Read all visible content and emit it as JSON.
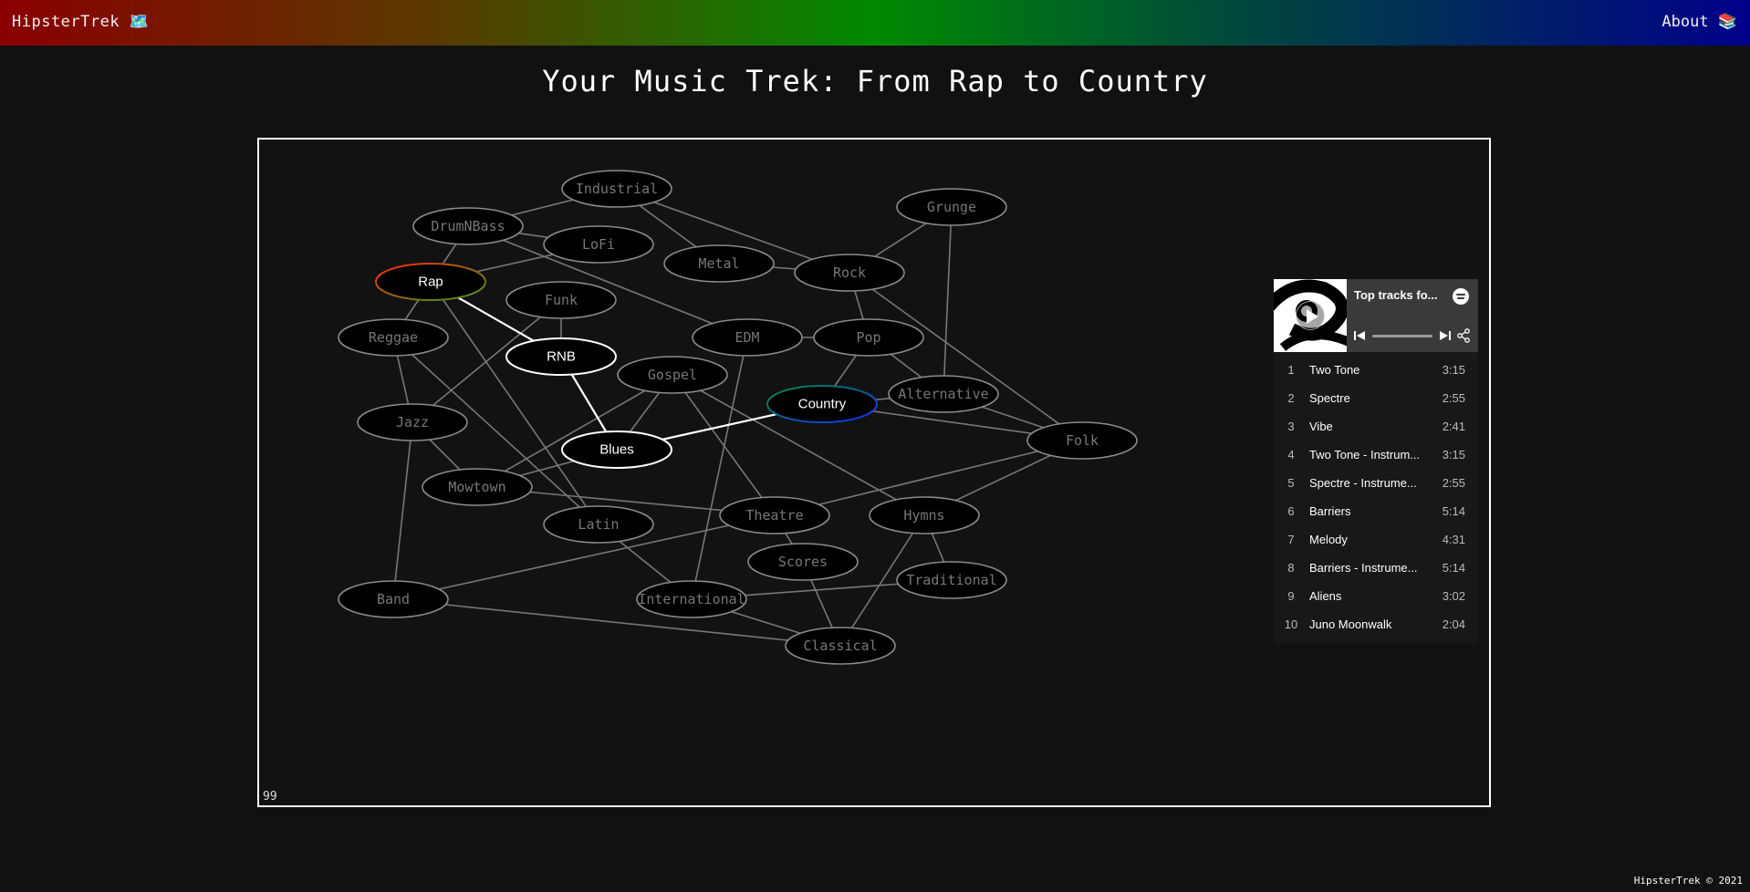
{
  "header": {
    "brand": "HipsterTrek 🗺️",
    "about": "About 📚"
  },
  "page_title": "Your Music Trek: From Rap to Country",
  "graph": {
    "counter": "99",
    "start_node": "Rap",
    "end_node": "Country",
    "path": [
      "Rap",
      "RNB",
      "Blues",
      "Country"
    ],
    "colors": {
      "start_stroke_a": "#ff2a00",
      "start_stroke_b": "#3a9a20",
      "end_stroke_a": "#008a3a",
      "end_stroke_b": "#1030ff",
      "dim_text": "#777777",
      "dim_edge": "#777777"
    },
    "nodes": [
      {
        "id": "Industrial",
        "label": "Industrial"
      },
      {
        "id": "Grunge",
        "label": "Grunge"
      },
      {
        "id": "DrumNBass",
        "label": "DrumNBass"
      },
      {
        "id": "LoFi",
        "label": "LoFi"
      },
      {
        "id": "Metal",
        "label": "Metal"
      },
      {
        "id": "Rock",
        "label": "Rock"
      },
      {
        "id": "Rap",
        "label": "Rap"
      },
      {
        "id": "Funk",
        "label": "Funk"
      },
      {
        "id": "Reggae",
        "label": "Reggae"
      },
      {
        "id": "RNB",
        "label": "RNB"
      },
      {
        "id": "EDM",
        "label": "EDM"
      },
      {
        "id": "Pop",
        "label": "Pop"
      },
      {
        "id": "Gospel",
        "label": "Gospel"
      },
      {
        "id": "Alternative",
        "label": "Alternative"
      },
      {
        "id": "Country",
        "label": "Country"
      },
      {
        "id": "Jazz",
        "label": "Jazz"
      },
      {
        "id": "Folk",
        "label": "Folk"
      },
      {
        "id": "Blues",
        "label": "Blues"
      },
      {
        "id": "Mowtown",
        "label": "Mowtown"
      },
      {
        "id": "Theatre",
        "label": "Theatre"
      },
      {
        "id": "Hymns",
        "label": "Hymns"
      },
      {
        "id": "Latin",
        "label": "Latin"
      },
      {
        "id": "Scores",
        "label": "Scores"
      },
      {
        "id": "Traditional",
        "label": "Traditional"
      },
      {
        "id": "Band",
        "label": "Band"
      },
      {
        "id": "International",
        "label": "International"
      },
      {
        "id": "Classical",
        "label": "Classical"
      }
    ],
    "edges": [
      [
        "DrumNBass",
        "Industrial"
      ],
      [
        "DrumNBass",
        "LoFi"
      ],
      [
        "DrumNBass",
        "Rap"
      ],
      [
        "DrumNBass",
        "EDM"
      ],
      [
        "Industrial",
        "Metal"
      ],
      [
        "Industrial",
        "Rock"
      ],
      [
        "LoFi",
        "Rap"
      ],
      [
        "Metal",
        "Rock"
      ],
      [
        "Grunge",
        "Rock"
      ],
      [
        "Grunge",
        "Alternative"
      ],
      [
        "Rock",
        "Pop"
      ],
      [
        "Rock",
        "Folk"
      ],
      [
        "Rap",
        "Reggae"
      ],
      [
        "Rap",
        "Latin"
      ],
      [
        "Rap",
        "RNB"
      ],
      [
        "Funk",
        "RNB"
      ],
      [
        "Funk",
        "Jazz"
      ],
      [
        "Reggae",
        "Jazz"
      ],
      [
        "Reggae",
        "Latin"
      ],
      [
        "RNB",
        "Blues"
      ],
      [
        "EDM",
        "Pop"
      ],
      [
        "EDM",
        "International"
      ],
      [
        "Pop",
        "Country"
      ],
      [
        "Pop",
        "Alternative"
      ],
      [
        "Gospel",
        "Blues"
      ],
      [
        "Gospel",
        "Mowtown"
      ],
      [
        "Gospel",
        "Theatre"
      ],
      [
        "Gospel",
        "Hymns"
      ],
      [
        "Alternative",
        "Country"
      ],
      [
        "Alternative",
        "Folk"
      ],
      [
        "Country",
        "Folk"
      ],
      [
        "Country",
        "Blues"
      ],
      [
        "Jazz",
        "Mowtown"
      ],
      [
        "Jazz",
        "Band"
      ],
      [
        "Mowtown",
        "Blues"
      ],
      [
        "Mowtown",
        "Theatre"
      ],
      [
        "Theatre",
        "Folk"
      ],
      [
        "Theatre",
        "Scores"
      ],
      [
        "Theatre",
        "Band"
      ],
      [
        "Hymns",
        "Folk"
      ],
      [
        "Hymns",
        "Traditional"
      ],
      [
        "Hymns",
        "Classical"
      ],
      [
        "Latin",
        "International"
      ],
      [
        "Scores",
        "Classical"
      ],
      [
        "International",
        "Traditional"
      ],
      [
        "International",
        "Classical"
      ],
      [
        "Band",
        "Classical"
      ]
    ]
  },
  "player": {
    "title": "Top tracks fo...",
    "tracks": [
      {
        "num": "1",
        "name": "Two Tone",
        "duration": "3:15"
      },
      {
        "num": "2",
        "name": "Spectre",
        "duration": "2:55"
      },
      {
        "num": "3",
        "name": "Vibe",
        "duration": "2:41"
      },
      {
        "num": "4",
        "name": "Two Tone - Instrum...",
        "duration": "3:15"
      },
      {
        "num": "5",
        "name": "Spectre - Instrume...",
        "duration": "2:55"
      },
      {
        "num": "6",
        "name": "Barriers",
        "duration": "5:14"
      },
      {
        "num": "7",
        "name": "Melody",
        "duration": "4:31"
      },
      {
        "num": "8",
        "name": "Barriers - Instrume...",
        "duration": "5:14"
      },
      {
        "num": "9",
        "name": "Aliens",
        "duration": "3:02"
      },
      {
        "num": "10",
        "name": "Juno Moonwalk",
        "duration": "2:04"
      }
    ]
  },
  "footer": "HipsterTrek © 2021"
}
